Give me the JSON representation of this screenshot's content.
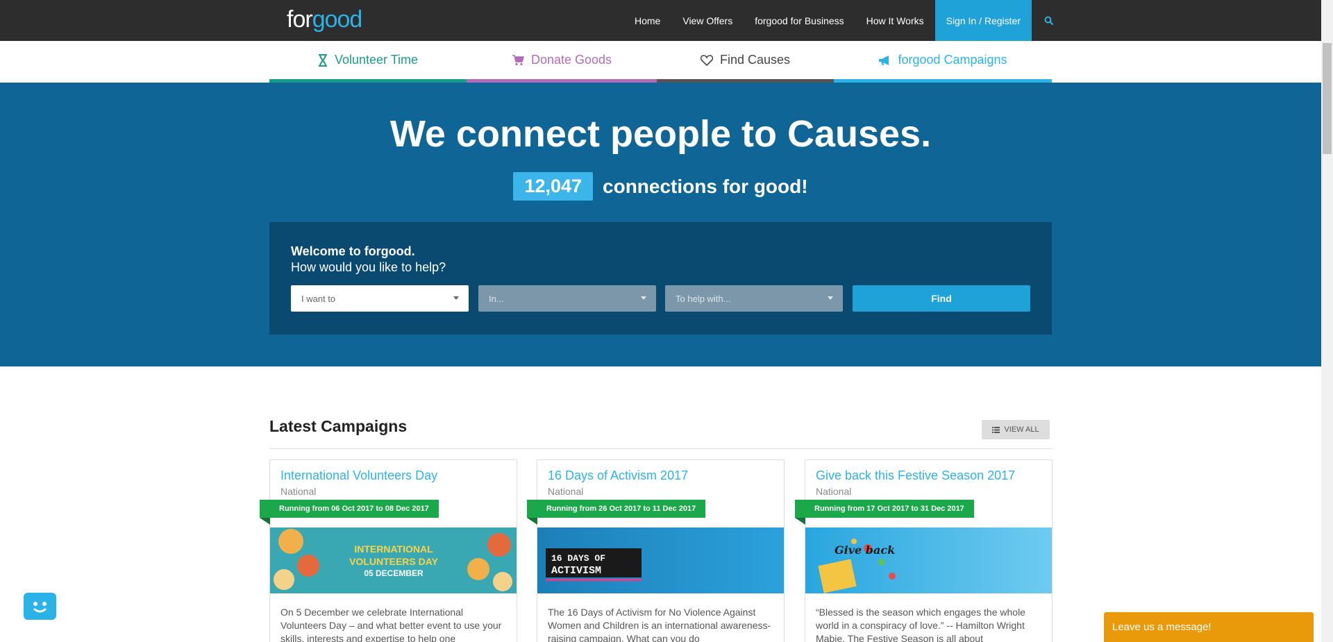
{
  "logo": {
    "part1": "for",
    "part2": "good"
  },
  "nav": {
    "home": "Home",
    "view_offers": "View Offers",
    "business": "forgood for Business",
    "how_it_works": "How It Works",
    "signin": "Sign In / Register"
  },
  "category_tabs": [
    {
      "label": "Volunteer Time",
      "icon": "hourglass-icon",
      "color": "#1a9b8a"
    },
    {
      "label": "Donate Goods",
      "icon": "cart-icon",
      "color": "#b26bb7"
    },
    {
      "label": "Find Causes",
      "icon": "heart-icon",
      "color": "#444444"
    },
    {
      "label": "forgood Campaigns",
      "icon": "megaphone-icon",
      "color": "#2bb3e8"
    }
  ],
  "hero": {
    "title": "We connect people to Causes.",
    "count": "12,047",
    "count_text": "connections for good!"
  },
  "search": {
    "welcome": "Welcome to forgood.",
    "prompt": "How would you like to help?",
    "select1": "I want to",
    "select2": "In...",
    "select3": "To help with...",
    "find": "Find"
  },
  "latest": {
    "title": "Latest Campaigns",
    "view_all": "VIEW ALL"
  },
  "campaigns": [
    {
      "title": "International Volunteers Day",
      "region": "National",
      "running": "Running from 06 Oct 2017 to 08 Dec 2017",
      "image_text_1": "INTERNATIONAL",
      "image_text_2": "VOLUNTEERS DAY",
      "image_text_3": "05 DECEMBER",
      "description": "On 5 December we celebrate International Volunteers Day – and what better event to use your skills, interests and expertise to help one"
    },
    {
      "title": "16 Days of Activism 2017",
      "region": "National",
      "running": "Running from 26 Oct 2017 to 11 Dec 2017",
      "image_text_1": "16 DAYS OF",
      "image_text_2": "ACTIVISM",
      "description": "The 16 Days of Activism for No Violence Against Women and Children is an international awareness-raising campaign. What can you do"
    },
    {
      "title": "Give back this Festive Season 2017",
      "region": "National",
      "running": "Running from 17 Oct 2017 to 31 Dec 2017",
      "image_text_1": "Give back",
      "description": "“Blessed is the season which engages the whole world in a conspiracy of love.” -- Hamilton Wright Mabie. The Festive Season is all about"
    }
  ],
  "chat": {
    "leave_message": "Leave us a message!"
  },
  "colors": {
    "nav_bg": "#2d2d2d",
    "hero_bg": "#0f6595",
    "accent": "#1fa2d8",
    "ribbon": "#1aa84a",
    "chat_orange": "#e89a0a"
  }
}
